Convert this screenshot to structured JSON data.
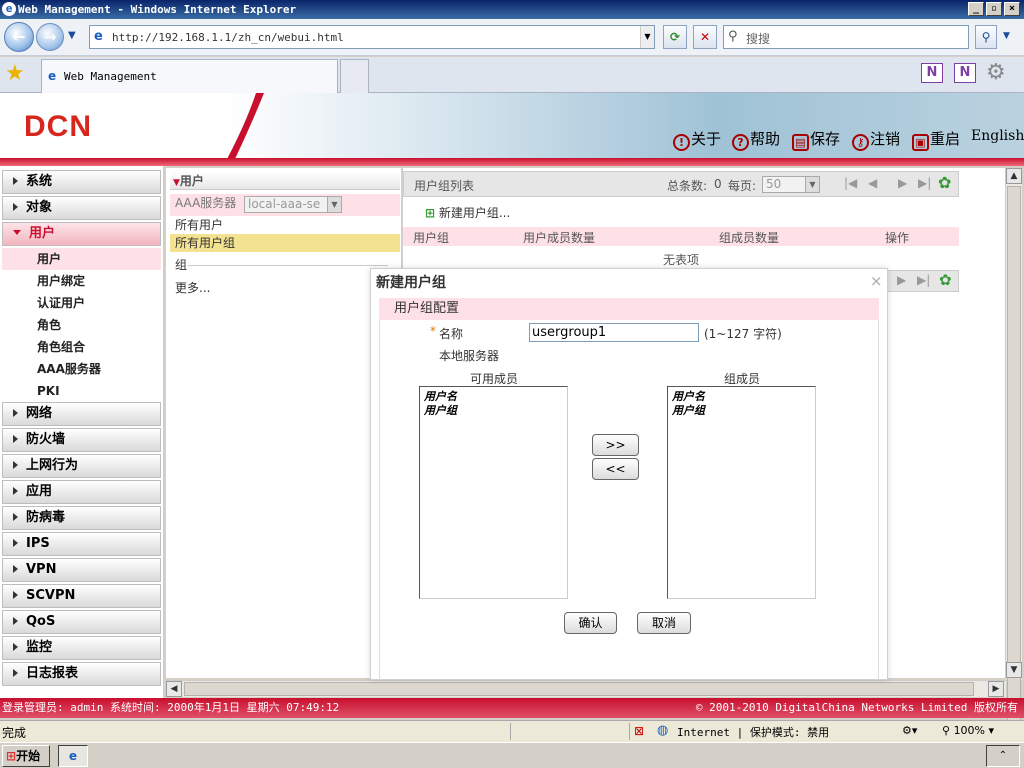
{
  "window": {
    "title": "Web Management - Windows Internet Explorer"
  },
  "browser": {
    "address": "http://192.168.1.1/zh_cn/webui.html",
    "search_placeholder": "搜搜",
    "tab_title": "Web Management"
  },
  "header": {
    "logo": "DCN",
    "actions": [
      {
        "label": "关于",
        "icon": "info-icon"
      },
      {
        "label": "帮助",
        "icon": "help-icon"
      },
      {
        "label": "保存",
        "icon": "save-icon"
      },
      {
        "label": "注销",
        "icon": "logout-icon"
      },
      {
        "label": "重启",
        "icon": "reboot-icon"
      },
      {
        "label": "English",
        "icon": ""
      }
    ]
  },
  "menu": {
    "top_items": [
      "系统",
      "对象"
    ],
    "open_item": "用户",
    "sub_items": [
      "用户",
      "用户绑定",
      "认证用户",
      "角色",
      "角色组合",
      "AAA服务器",
      "PKI"
    ],
    "bottom_items": [
      "网络",
      "防火墙",
      "上网行为",
      "应用",
      "防病毒",
      "IPS",
      "VPN",
      "SCVPN",
      "QoS",
      "监控",
      "日志报表"
    ]
  },
  "middle": {
    "title": "用户",
    "aaa_label": "AAA服务器",
    "aaa_value": "local-aaa-se",
    "all_users": "所有用户",
    "all_groups": "所有用户组",
    "group_label": "组",
    "more": "更多..."
  },
  "list": {
    "title": "用户组列表",
    "total_label": "总条数:",
    "total_value": "0",
    "per_page_label": "每页:",
    "per_page_value": "50",
    "new_button": "新建用户组...",
    "columns": [
      "用户组",
      "用户成员数量",
      "组成员数量",
      "操作"
    ],
    "empty": "无表项"
  },
  "dialog": {
    "title": "新建用户组",
    "section": "用户组配置",
    "required_mark": "*",
    "name_label": "名称",
    "name_value": "usergroup1",
    "name_hint": "(1~127 字符)",
    "server_label": "本地服务器",
    "available_label": "可用成员",
    "available_items": [
      "用户名",
      "用户组"
    ],
    "members_label": "组成员",
    "member_items": [
      "用户名",
      "用户组"
    ],
    "add_button": ">>",
    "remove_button": "<<",
    "ok_button": "确认",
    "cancel_button": "取消"
  },
  "footer": {
    "left": "登录管理员: admin 系统时间: 2000年1月1日 星期六 07:49:12",
    "right": "© 2001-2010 DigitalChina Networks Limited 版权所有"
  },
  "status": {
    "left": "完成",
    "zone": "Internet | 保护模式: 禁用",
    "zoom": "100%"
  },
  "taskbar": {
    "start": "开始"
  },
  "colors": {
    "brand_red": "#c8102e",
    "pink": "#fde1e6"
  }
}
